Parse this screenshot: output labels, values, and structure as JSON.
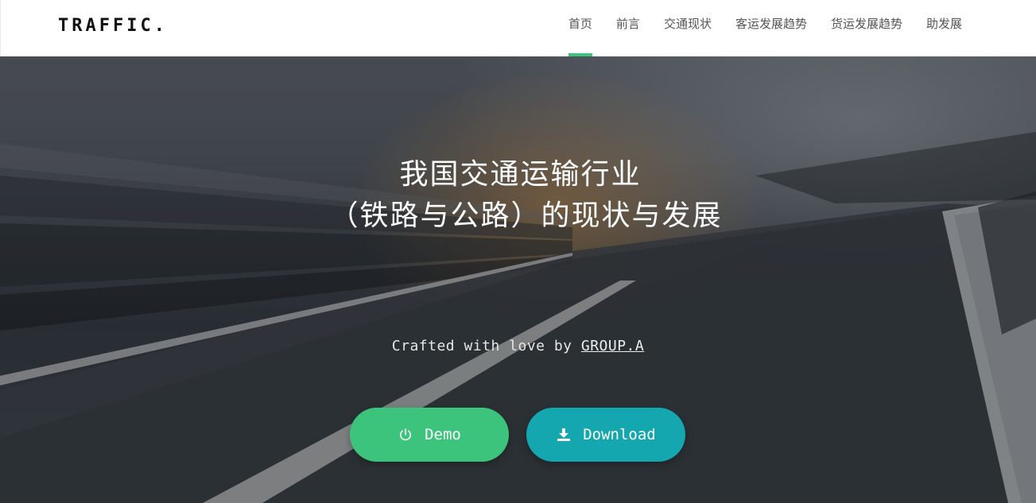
{
  "brand": "TRAFFIC.",
  "nav": {
    "items": [
      "首页",
      "前言",
      "交通现状",
      "客运发展趋势",
      "货运发展趋势",
      "助发展"
    ],
    "active_index": 0
  },
  "hero": {
    "title_line1": "我国交通运输行业",
    "title_line2": "（铁路与公路）的现状与发展",
    "credit_prefix": "Crafted with love by ",
    "credit_link": "GROUP.A"
  },
  "buttons": {
    "demo_label": "Demo",
    "download_label": "Download"
  },
  "colors": {
    "accent": "#3cc47c",
    "download": "#14a7b0"
  }
}
